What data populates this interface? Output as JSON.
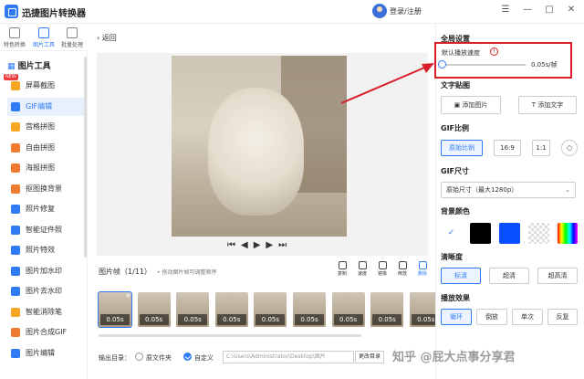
{
  "app": {
    "title": "迅捷图片转换器",
    "login": "登录/注册"
  },
  "sidebar_tabs": [
    "特色转换",
    "图片工具",
    "批量处理"
  ],
  "sidebar": {
    "category": "图片工具",
    "badge": "NEW",
    "items": [
      {
        "label": "屏幕截图",
        "color": "#f5a623"
      },
      {
        "label": "GIF编辑",
        "color": "#2f7bf5"
      },
      {
        "label": "宫格拼图",
        "color": "#f5a623"
      },
      {
        "label": "自由拼图",
        "color": "#f07a2f"
      },
      {
        "label": "海报拼图",
        "color": "#f07a2f"
      },
      {
        "label": "抠图换背景",
        "color": "#f07a2f"
      },
      {
        "label": "照片修复",
        "color": "#2f7bf5"
      },
      {
        "label": "智能证件照",
        "color": "#2f7bf5"
      },
      {
        "label": "照片特效",
        "color": "#2f7bf5"
      },
      {
        "label": "图片加水印",
        "color": "#2f7bf5"
      },
      {
        "label": "图片去水印",
        "color": "#2f7bf5"
      },
      {
        "label": "智能消除笔",
        "color": "#f5a623"
      },
      {
        "label": "图片合成GIF",
        "color": "#f07a2f"
      },
      {
        "label": "图片编辑",
        "color": "#2f7bf5"
      }
    ]
  },
  "main": {
    "back": "返回",
    "frames_label": "图片帧（1/11）",
    "frames_hint": "• 拖动图片帧可调整顺序",
    "frame_tools": [
      "复制",
      "速度",
      "镜像",
      "倒放",
      "删除"
    ],
    "frames": [
      "0.05s",
      "0.05s",
      "0.05s",
      "0.05s",
      "0.05s",
      "0.05s",
      "0.05s",
      "0.05s",
      "0.05s"
    ],
    "output_label": "输出目录：",
    "output_options": [
      "原文件夹",
      "自定义"
    ],
    "output_path": "C:\\Users\\Administrator\\Desktop\\图片",
    "change_dir": "更改目录"
  },
  "right": {
    "global_title": "全局设置",
    "speed_label": "默认播放速度",
    "speed_value": "0.05s/帧",
    "speed_fraction": 0.02,
    "text_sticker_title": "文字贴图",
    "add_image": "添加图片",
    "add_text": "添加文字",
    "ratio_title": "GIF比例",
    "ratios": [
      "原始比例",
      "16:9",
      "1:1"
    ],
    "size_title": "GIF尺寸",
    "size_value": "原始尺寸（最大1280p）",
    "bg_title": "背景颜色",
    "bg_colors": [
      "#000000",
      "#0a4fff"
    ],
    "clarity_title": "清晰度",
    "clarity": [
      "标清",
      "超清",
      "超高清"
    ],
    "play_title": "播放效果",
    "play": [
      "循环",
      "倒放",
      "单次",
      "反复"
    ]
  },
  "watermark": "知乎 @屁大点事分享君"
}
